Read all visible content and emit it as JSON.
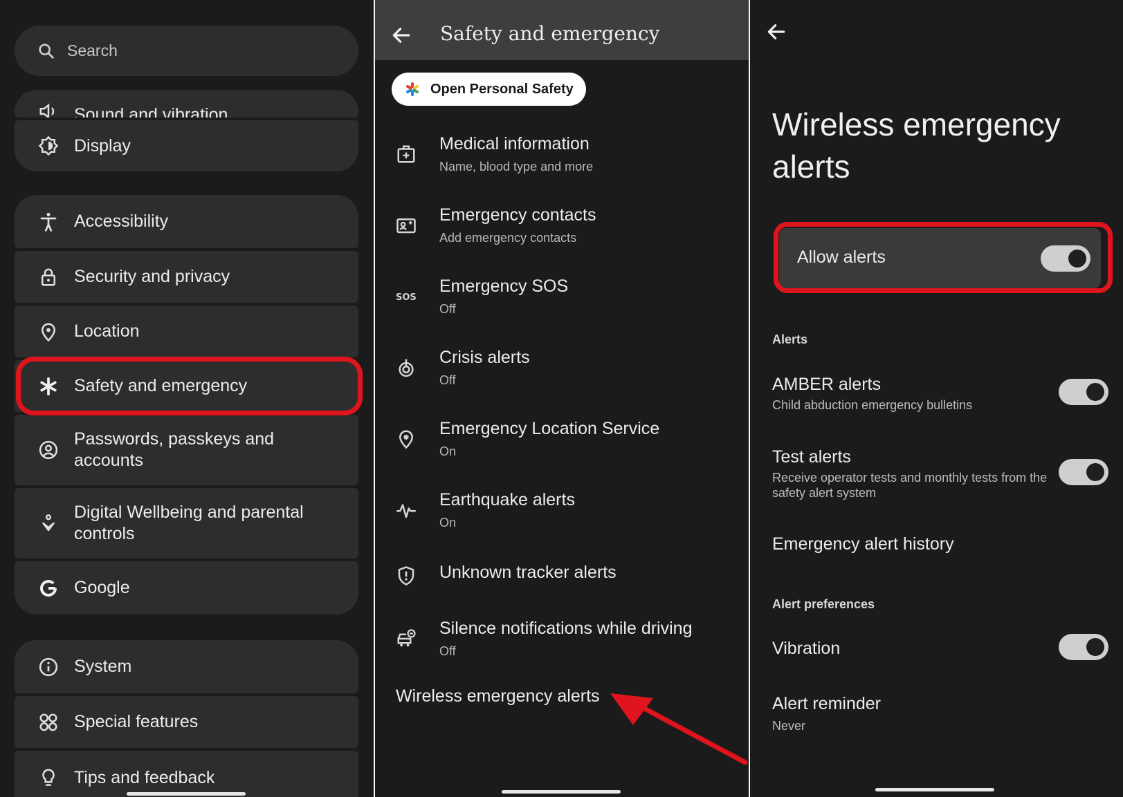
{
  "settings_list": {
    "search_placeholder": "Search",
    "items": [
      {
        "label": "Sound and vibration",
        "icon": "speaker-icon"
      },
      {
        "label": "Display",
        "icon": "brightness-icon"
      },
      {
        "label": "Accessibility",
        "icon": "accessibility-icon"
      },
      {
        "label": "Security and privacy",
        "icon": "lock-icon"
      },
      {
        "label": "Location",
        "icon": "location-pin-icon"
      },
      {
        "label": "Safety and emergency",
        "icon": "asterisk-icon"
      },
      {
        "label": "Passwords, passkeys and accounts",
        "icon": "account-circle-icon"
      },
      {
        "label": "Digital Wellbeing and parental controls",
        "icon": "wellbeing-icon"
      },
      {
        "label": "Google",
        "icon": "google-icon"
      },
      {
        "label": "System",
        "icon": "info-icon"
      },
      {
        "label": "Special features",
        "icon": "special-features-icon"
      },
      {
        "label": "Tips and feedback",
        "icon": "lightbulb-icon"
      }
    ],
    "highlight_color": "#e0141c"
  },
  "safety": {
    "title": "Safety and emergency",
    "chip_label": "Open Personal Safety",
    "items": [
      {
        "title": "Medical information",
        "subtitle": "Name, blood type and more",
        "icon": "medical-id-icon"
      },
      {
        "title": "Emergency contacts",
        "subtitle": "Add emergency contacts",
        "icon": "contact-card-icon"
      },
      {
        "title": "Emergency SOS",
        "subtitle": "Off",
        "icon": "sos-icon"
      },
      {
        "title": "Crisis alerts",
        "subtitle": "Off",
        "icon": "crisis-alert-icon"
      },
      {
        "title": "Emergency Location Service",
        "subtitle": "On",
        "icon": "emergency-location-icon"
      },
      {
        "title": "Earthquake alerts",
        "subtitle": "On",
        "icon": "earthquake-icon"
      },
      {
        "title": "Unknown tracker alerts",
        "subtitle": "",
        "icon": "shield-alert-icon"
      },
      {
        "title": "Silence notifications while driving",
        "subtitle": "Off",
        "icon": "car-silence-icon"
      }
    ],
    "wireless_label": "Wireless emergency alerts"
  },
  "wea": {
    "title": "Wireless emergency alerts",
    "allow_label": "Allow alerts",
    "allow_on": true,
    "section_alerts": "Alerts",
    "amber_title": "AMBER alerts",
    "amber_sub": "Child abduction emergency bulletins",
    "amber_on": true,
    "test_title": "Test alerts",
    "test_sub": "Receive operator tests and monthly tests from the safety alert system",
    "test_on": true,
    "history_title": "Emergency alert history",
    "section_prefs": "Alert preferences",
    "vibration_title": "Vibration",
    "vibration_on": true,
    "reminder_title": "Alert reminder",
    "reminder_sub": "Never"
  }
}
